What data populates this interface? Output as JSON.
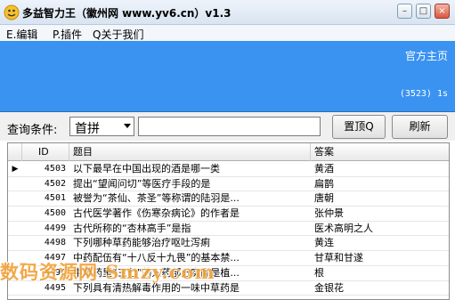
{
  "window": {
    "title": "多益智力王（徽州网 www.yv6.cn）v1.3",
    "controls": {
      "minimize": "–",
      "maximize": "□",
      "close": "×"
    }
  },
  "menu": [
    {
      "label": "E.编辑"
    },
    {
      "label": "P.插件"
    },
    {
      "label": "Q关于我们"
    }
  ],
  "banner": {
    "home_link": "官方主页",
    "timer": "(3523) 1s",
    "color": "#3a93f1"
  },
  "toolbar": {
    "query_label": "查询条件:",
    "mode_value": "首拼",
    "search_value": "",
    "top_button": "置顶Q",
    "refresh_button": "刷新"
  },
  "table": {
    "columns": [
      "ID",
      "题目",
      "答案"
    ],
    "rows": [
      {
        "id": "4503",
        "question": "以下最早在中国出现的酒是哪一类",
        "answer": "黄酒",
        "current": true
      },
      {
        "id": "4502",
        "question": "提出“望闻问切”等医疗手段的是",
        "answer": "扁鹊"
      },
      {
        "id": "4501",
        "question": "被誉为“茶仙、茶圣”等称谓的陆羽是...",
        "answer": "唐朝"
      },
      {
        "id": "4500",
        "question": "古代医学著作《伤寒杂病论》的作者是",
        "answer": "张仲景"
      },
      {
        "id": "4499",
        "question": "古代所称的“杏林高手”是指",
        "answer": "医术高明之人"
      },
      {
        "id": "4498",
        "question": "下列哪种草药能够治疗呕吐泻痢",
        "answer": "黄连"
      },
      {
        "id": "4497",
        "question": "中药配伍有“十八反十九畏”的基本禁...",
        "answer": "甘草和甘遂"
      },
      {
        "id": "4496",
        "question": "中草药里“三七”的入药部分实际是植...",
        "answer": "根"
      },
      {
        "id": "4495",
        "question": "下列具有清热解毒作用的一味中草药是",
        "answer": "金银花"
      }
    ],
    "row_indicator": "▶"
  },
  "watermark": "数码资源网 Smzy.com"
}
